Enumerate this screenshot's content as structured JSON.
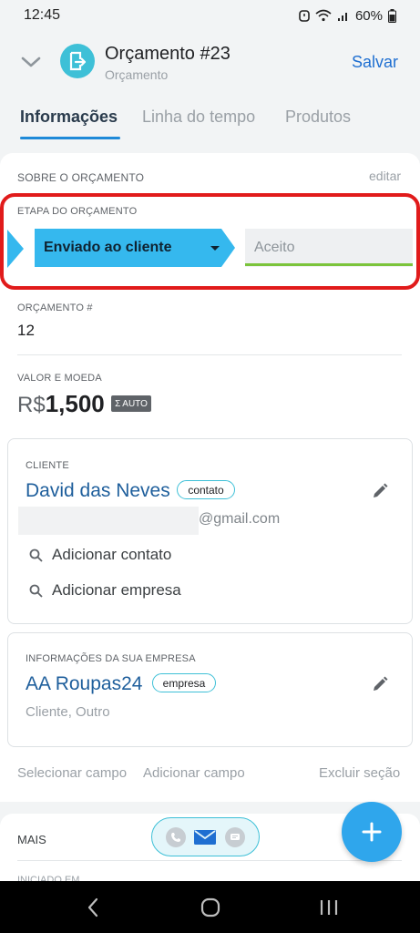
{
  "status_bar": {
    "time": "12:45",
    "battery": "60%",
    "icons": [
      "alarm-icon",
      "wifi-icon",
      "signal-icon",
      "battery-icon"
    ]
  },
  "header": {
    "title": "Orçamento #23",
    "subtitle": "Orçamento",
    "save_label": "Salvar",
    "avatar_icon": "document-export-icon"
  },
  "tabs": [
    {
      "label": "Informações",
      "active": true
    },
    {
      "label": "Linha do tempo",
      "active": false
    },
    {
      "label": "Produtos",
      "active": false
    }
  ],
  "about": {
    "section_title": "SOBRE O ORÇAMENTO",
    "edit_label": "editar",
    "stage_label": "ETAPA DO ORÇAMENTO",
    "stage_current": "Enviado ao cliente",
    "stage_next": "Aceito",
    "number_label": "ORÇAMENTO #",
    "number_value": "12",
    "value_label": "VALOR E MOEDA",
    "currency": "R$",
    "amount": "1,500",
    "auto_badge": "AUTO"
  },
  "client_card": {
    "label": "CLIENTE",
    "name": "David das Neves",
    "chip": "contato",
    "email_suffix": "@gmail.com",
    "add_contact": "Adicionar contato",
    "add_company": "Adicionar empresa"
  },
  "company_card": {
    "label": "INFORMAÇÕES DA SUA EMPRESA",
    "name": "AA Roupas24",
    "chip": "empresa",
    "subtitle": "Cliente, Outro"
  },
  "section_actions": {
    "select_field": "Selecionar campo",
    "add_field": "Adicionar campo",
    "delete_section": "Excluir seção"
  },
  "more": {
    "title": "MAIS",
    "partial_label": "INICIADO EM"
  },
  "colors": {
    "accent": "#1f6fd1",
    "stage_active": "#35b8ee",
    "highlight_border": "#e11b1b",
    "progress": "#7bc43b",
    "fab": "#2fa6ec"
  }
}
